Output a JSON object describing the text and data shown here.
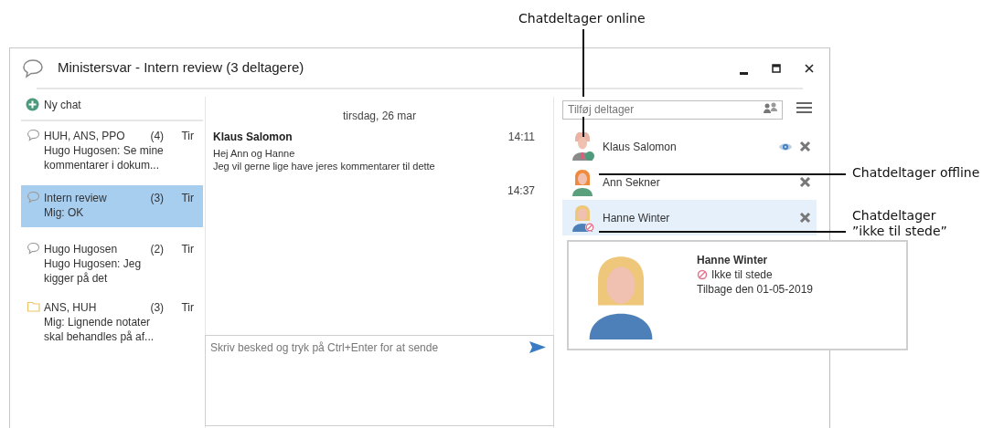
{
  "window": {
    "title": "Ministersvar - Intern review (3 deltagere)"
  },
  "conversations": {
    "new_chat_label": "Ny chat",
    "items": [
      {
        "kind": "chat",
        "title": "HUH, ANS, PPO",
        "count": "(4)",
        "day": "Tir",
        "preview": "Hugo Hugosen: Se mine kommentarer i dokum...",
        "selected": false
      },
      {
        "kind": "chat",
        "title": "Intern review",
        "count": "(3)",
        "day": "Tir",
        "preview": "Mig: OK",
        "selected": true
      },
      {
        "kind": "chat",
        "title": "Hugo Hugosen",
        "count": "(2)",
        "day": "Tir",
        "preview": "Hugo Hugosen: Jeg kigger på det",
        "selected": false
      },
      {
        "kind": "note",
        "title": "ANS, HUH",
        "count": "(3)",
        "day": "Tir",
        "preview": "Mig: Lignende notater skal behandles på af...",
        "selected": false
      }
    ]
  },
  "messages": {
    "date": "tirsdag, 26 mar",
    "items": [
      {
        "sender": "Klaus Salomon",
        "time": "14:11",
        "lines": [
          "Hej Ann og Hanne",
          "Jeg vil gerne lige have jeres kommentarer til dette"
        ]
      },
      {
        "time": "14:37"
      }
    ]
  },
  "compose": {
    "placeholder": "Skriv besked og tryk på Ctrl+Enter for at sende"
  },
  "participants": {
    "search_placeholder": "Tilføj deltager",
    "items": [
      {
        "name": "Klaus Salomon",
        "kind": "man",
        "online": true,
        "away": false,
        "watching": true,
        "selected": false
      },
      {
        "name": "Ann Sekner",
        "kind": "redhead",
        "online": false,
        "away": false,
        "watching": false,
        "selected": false
      },
      {
        "name": "Hanne Winter",
        "kind": "blonde",
        "online": false,
        "away": true,
        "watching": false,
        "selected": true
      }
    ]
  },
  "contact_card": {
    "name": "Hanne Winter",
    "away": true,
    "status_text": "Ikke til stede",
    "note": "Tilbage den 01-05-2019"
  },
  "annotations": [
    {
      "lines": [
        "Chatdeltager online"
      ]
    },
    {
      "lines": [
        "Chatdeltager offline"
      ]
    },
    {
      "lines": [
        "Chatdeltager",
        "”ikke til stede”"
      ]
    }
  ]
}
